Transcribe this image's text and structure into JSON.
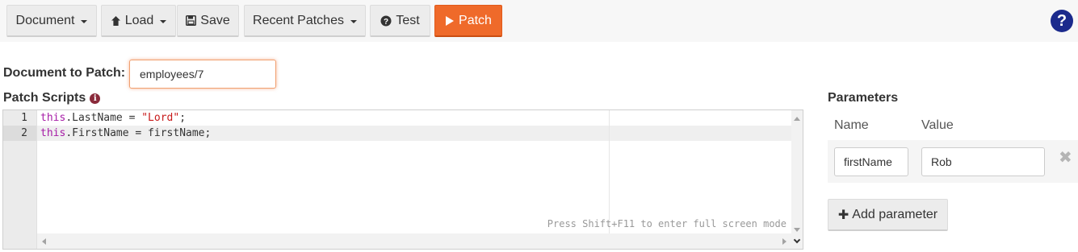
{
  "toolbar": {
    "document_label": "Document",
    "load_label": "Load",
    "save_label": "Save",
    "recent_patches_label": "Recent Patches",
    "test_label": "Test",
    "patch_label": "Patch",
    "help_icon": "?"
  },
  "icons": {
    "load": "arrow-up-icon",
    "save": "floppy-disk-icon",
    "test": "question-circle-icon",
    "patch": "play-icon",
    "help": "question-circle-icon",
    "info": "info-circle-icon",
    "remove": "close-icon",
    "add": "plus-icon"
  },
  "colors": {
    "accent": "#ef6a2a",
    "help": "#1b2a8c",
    "keyword": "#a61ba6",
    "string": "#c81a1a"
  },
  "document": {
    "label": "Document to Patch:",
    "value": "employees/7"
  },
  "scripts": {
    "label": "Patch Scripts",
    "info_icon": "i",
    "line_numbers": [
      "1",
      "2"
    ],
    "lines": [
      [
        {
          "cls": "kw",
          "text": "this"
        },
        {
          "cls": "op",
          "text": ".LastName = "
        },
        {
          "cls": "str",
          "text": "\"Lord\""
        },
        {
          "cls": "op",
          "text": ";"
        }
      ],
      [
        {
          "cls": "kw",
          "text": "this"
        },
        {
          "cls": "op",
          "text": ".FirstName = firstName;"
        }
      ]
    ],
    "fullscreen_hint": "Press Shift+F11 to enter full screen mode"
  },
  "parameters": {
    "title": "Parameters",
    "name_header": "Name",
    "value_header": "Value",
    "rows": [
      {
        "name": "firstName",
        "value": "Rob"
      }
    ],
    "remove_glyph": "✖",
    "add_label": "Add parameter",
    "add_glyph": "✚"
  }
}
